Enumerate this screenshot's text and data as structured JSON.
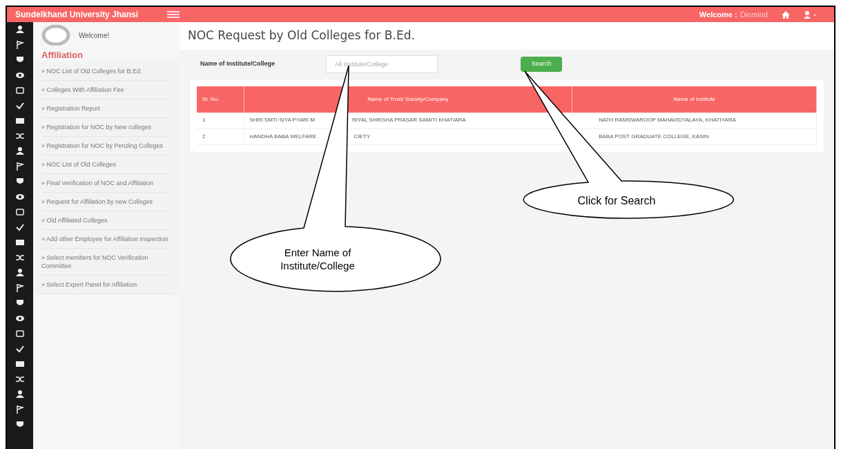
{
  "header": {
    "brand": "Sundelkhand University Jhansi",
    "welcome_label": "Welcome :",
    "user_name": "Dinmind"
  },
  "sidebar": {
    "greeting": "Welcome!",
    "section": "Affiliation",
    "items": [
      {
        "label": "» NOC List of Old Colleges for B.Ed."
      },
      {
        "label": "» Colleges With Affiliation Fee"
      },
      {
        "label": "» Registration Report"
      },
      {
        "label": "» Registration for NOC by New colleges"
      },
      {
        "label": "» Registration for NOC by Pending Colleges"
      },
      {
        "label": "» NOC List of Old Colleges"
      },
      {
        "label": "» Final Verification of NOC and Affiliation"
      },
      {
        "label": "» Request for Affiliation by new Colleges"
      },
      {
        "label": "» Old Affiliated Colleges"
      },
      {
        "label": "» Add other Employee for Affiliation Inspection"
      },
      {
        "label": "» Select members for NOC Verification Committee"
      },
      {
        "label": "» Select Expert Panel for Affiliation"
      }
    ]
  },
  "page_title": "NOC Request by Old Colleges for B.Ed.",
  "search": {
    "label": "Name of Institute/College",
    "placeholder": "All Institute/College",
    "button": "Search"
  },
  "table": {
    "columns": [
      "Sr. No.",
      "Name of Trust/ Society/Company",
      "Name of Institute"
    ],
    "rows": [
      [
        "1",
        [
          "SHRI SMTI SIYA PYARI M",
          "RIYAL SHIKSHA PRASAR SAMITI KHATIARA"
        ],
        [
          "NATH RAMSWAROOP MAHAVIDYALAYA, KHATIYARA"
        ]
      ],
      [
        "2",
        [
          "HANDHA BABA WELFARE",
          "CIETY"
        ],
        [
          "BABA POST GRADUATE COLLEGE, KASIN"
        ]
      ]
    ]
  },
  "callouts": [
    {
      "text": "Enter Name of Institute/College"
    },
    {
      "text": "Click for Search"
    }
  ]
}
